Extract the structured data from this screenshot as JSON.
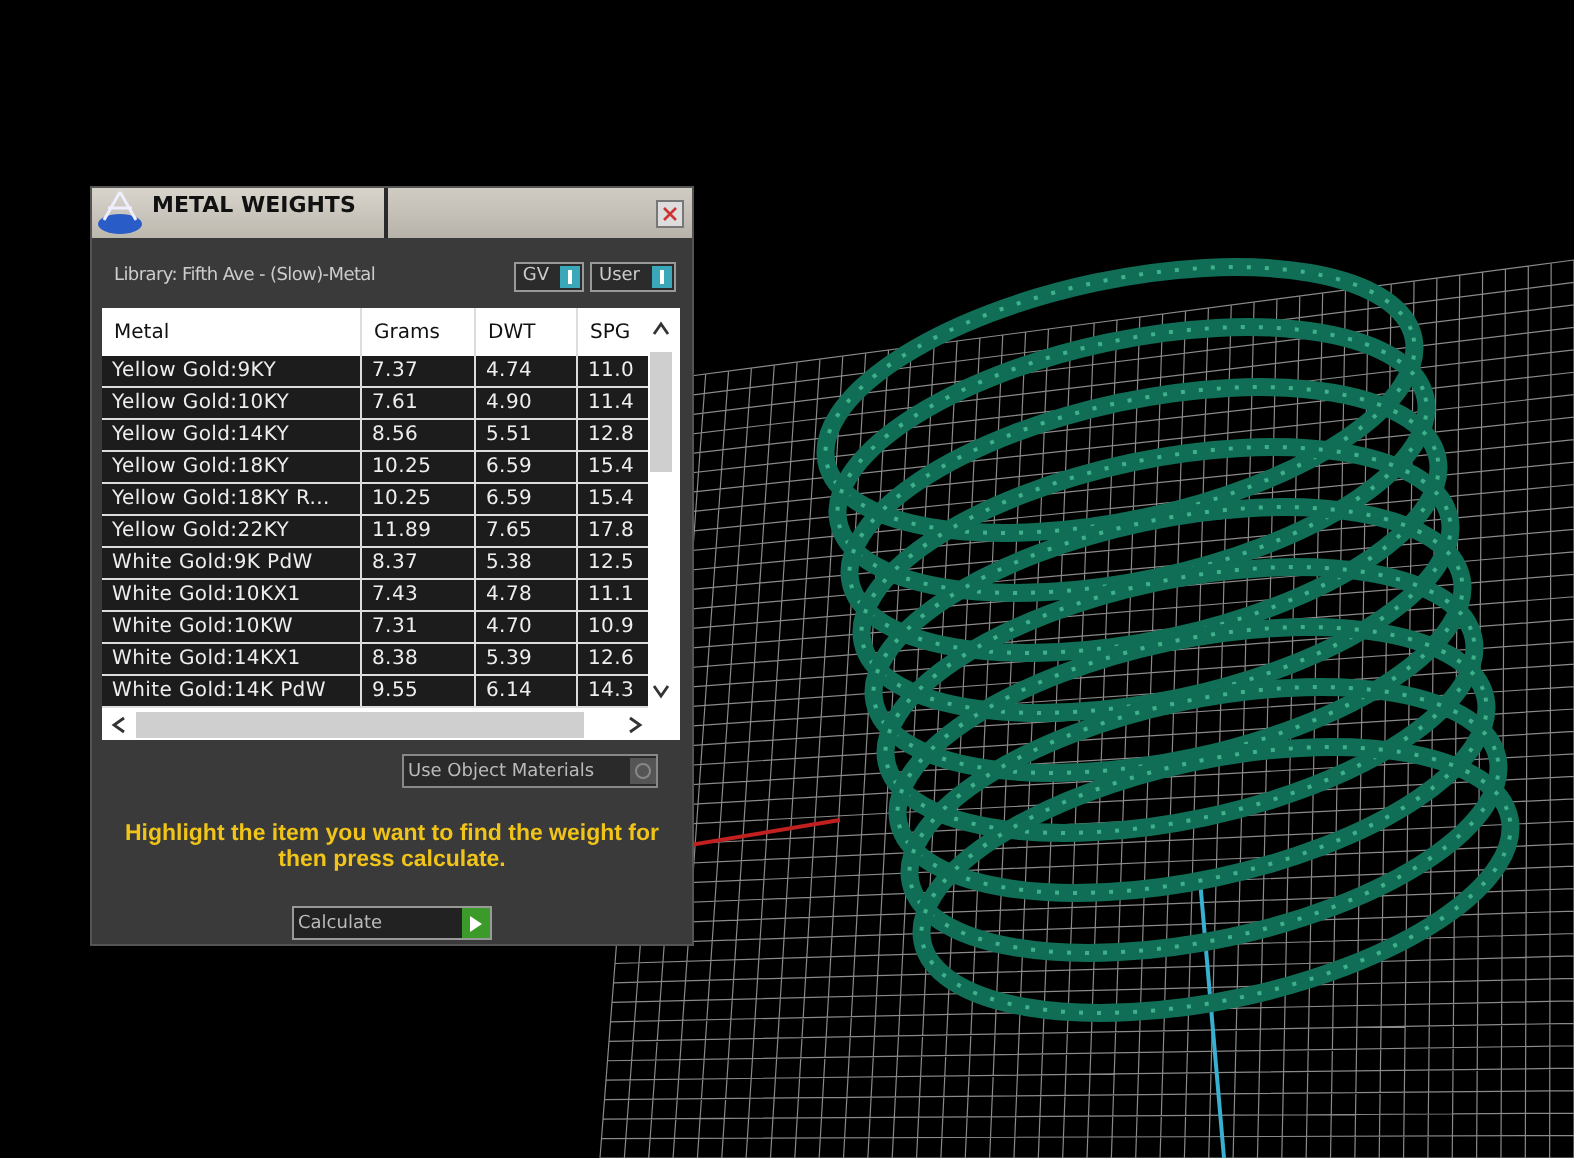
{
  "panel": {
    "title": "METAL WEIGHTS",
    "library": "Library: Fifth Ave - (Slow)-Metal",
    "toggles": [
      {
        "label": "GV",
        "on": true
      },
      {
        "label": "User",
        "on": true
      }
    ],
    "table": {
      "columns": [
        "Metal",
        "Grams",
        "DWT",
        "SPG"
      ],
      "rows": [
        {
          "cells": [
            "Yellow Gold:9KY",
            "7.37",
            "4.74",
            "11.0"
          ]
        },
        {
          "cells": [
            "Yellow Gold:10KY",
            "7.61",
            "4.90",
            "11.4"
          ]
        },
        {
          "cells": [
            "Yellow Gold:14KY",
            "8.56",
            "5.51",
            "12.8"
          ]
        },
        {
          "cells": [
            "Yellow Gold:18KY",
            "10.25",
            "6.59",
            "15.4"
          ]
        },
        {
          "cells": [
            "Yellow Gold:18KY R...",
            "10.25",
            "6.59",
            "15.4"
          ]
        },
        {
          "cells": [
            "Yellow Gold:22KY",
            "11.89",
            "7.65",
            "17.8"
          ]
        },
        {
          "cells": [
            "White Gold:9K PdW",
            "8.37",
            "5.38",
            "12.5"
          ]
        },
        {
          "cells": [
            "White Gold:10KX1",
            "7.43",
            "4.78",
            "11.1"
          ]
        },
        {
          "cells": [
            "White Gold:10KW",
            "7.31",
            "4.70",
            "10.9"
          ]
        },
        {
          "cells": [
            "White Gold:14KX1",
            "8.38",
            "5.39",
            "12.6"
          ]
        },
        {
          "cells": [
            "White Gold:14K PdW",
            "9.55",
            "6.14",
            "14.3"
          ]
        }
      ]
    },
    "use_object_materials": {
      "label": "Use Object Materials",
      "checked": false
    },
    "hint": "Highlight the item you want to find the weight for then press calculate.",
    "calculate_button": "Calculate"
  }
}
